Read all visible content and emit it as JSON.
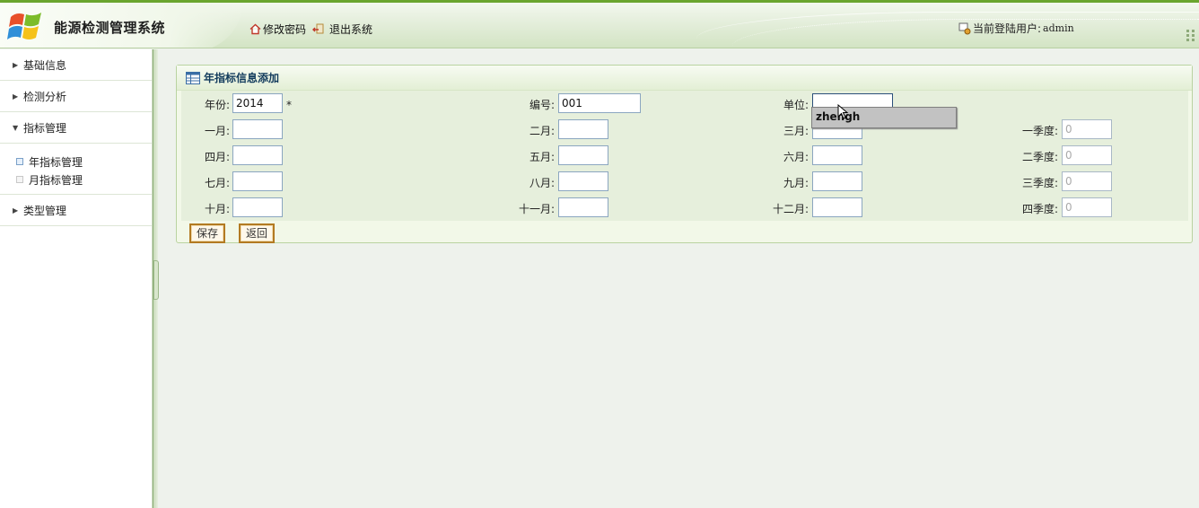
{
  "app": {
    "title": "能源检测管理系统"
  },
  "header": {
    "change_password": "修改密码",
    "logout": "退出系统",
    "current_user_label": "当前登陆用户:",
    "current_user": "admin"
  },
  "sidebar": {
    "items": [
      {
        "label": "基础信息",
        "expanded": false
      },
      {
        "label": "检测分析",
        "expanded": false
      },
      {
        "label": "指标管理",
        "expanded": true
      },
      {
        "label": "类型管理",
        "expanded": false
      }
    ],
    "sub_items": [
      {
        "label": "年指标管理",
        "active": true
      },
      {
        "label": "月指标管理",
        "active": false
      }
    ]
  },
  "panel": {
    "title": "年指标信息添加"
  },
  "form": {
    "year": {
      "label": "年份:",
      "value": "2014",
      "required_mark": "*"
    },
    "code": {
      "label": "编号:",
      "value": "001"
    },
    "unit": {
      "label": "单位:",
      "value": ""
    },
    "months": [
      {
        "label": "一月:",
        "value": ""
      },
      {
        "label": "二月:",
        "value": ""
      },
      {
        "label": "三月:",
        "value": ""
      },
      {
        "label": "四月:",
        "value": ""
      },
      {
        "label": "五月:",
        "value": ""
      },
      {
        "label": "六月:",
        "value": ""
      },
      {
        "label": "七月:",
        "value": ""
      },
      {
        "label": "八月:",
        "value": ""
      },
      {
        "label": "九月:",
        "value": ""
      },
      {
        "label": "十月:",
        "value": ""
      },
      {
        "label": "十一月:",
        "value": ""
      },
      {
        "label": "十二月:",
        "value": ""
      }
    ],
    "quarters": [
      {
        "label": "一季度:",
        "value": "0"
      },
      {
        "label": "二季度:",
        "value": "0"
      },
      {
        "label": "三季度:",
        "value": "0"
      },
      {
        "label": "四季度:",
        "value": "0"
      }
    ],
    "autocomplete_suggestion": "zhengh"
  },
  "buttons": {
    "save": "保存",
    "back": "返回"
  },
  "colors": {
    "accent": "#6aa52e",
    "panel_title": "#123b5c",
    "button_border": "#b37a22"
  }
}
